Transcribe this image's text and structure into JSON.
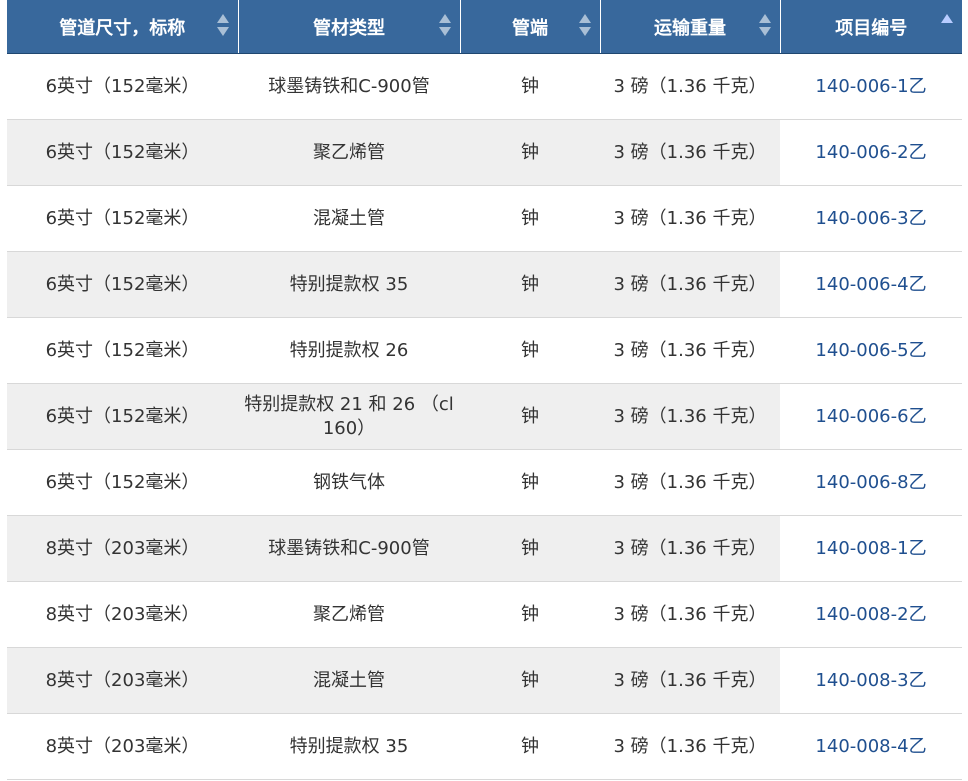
{
  "table": {
    "headers": [
      "管道尺寸，标称",
      "管材类型",
      "管端",
      "运输重量",
      "项目编号"
    ],
    "rows": [
      {
        "size": "6英寸（152毫米）",
        "material": "球墨铸铁和C-900管",
        "end": "钟",
        "weight": "3 磅（1.36 千克）",
        "item": "140-006-1乙"
      },
      {
        "size": "6英寸（152毫米）",
        "material": "聚乙烯管",
        "end": "钟",
        "weight": "3 磅（1.36 千克）",
        "item": "140-006-2乙"
      },
      {
        "size": "6英寸（152毫米）",
        "material": "混凝土管",
        "end": "钟",
        "weight": "3 磅（1.36 千克）",
        "item": "140-006-3乙"
      },
      {
        "size": "6英寸（152毫米）",
        "material": "特别提款权 35",
        "end": "钟",
        "weight": "3 磅（1.36 千克）",
        "item": "140-006-4乙"
      },
      {
        "size": "6英寸（152毫米）",
        "material": "特别提款权 26",
        "end": "钟",
        "weight": "3 磅（1.36 千克）",
        "item": "140-006-5乙"
      },
      {
        "size": "6英寸（152毫米）",
        "material": "特别提款权 21 和 26 （cl 160）",
        "end": "钟",
        "weight": "3 磅（1.36 千克）",
        "item": "140-006-6乙"
      },
      {
        "size": "6英寸（152毫米）",
        "material": "钢铁气体",
        "end": "钟",
        "weight": "3 磅（1.36 千克）",
        "item": "140-006-8乙"
      },
      {
        "size": "8英寸（203毫米）",
        "material": "球墨铸铁和C-900管",
        "end": "钟",
        "weight": "3 磅（1.36 千克）",
        "item": "140-008-1乙"
      },
      {
        "size": "8英寸（203毫米）",
        "material": "聚乙烯管",
        "end": "钟",
        "weight": "3 磅（1.36 千克）",
        "item": "140-008-2乙"
      },
      {
        "size": "8英寸（203毫米）",
        "material": "混凝土管",
        "end": "钟",
        "weight": "3 磅（1.36 千克）",
        "item": "140-008-3乙"
      },
      {
        "size": "8英寸（203毫米）",
        "material": "特别提款权 35",
        "end": "钟",
        "weight": "3 磅（1.36 千克）",
        "item": "140-008-4乙"
      }
    ]
  },
  "colors": {
    "header_bg": "#38689c",
    "stripe_bg": "#efefef",
    "item_text": "#1f4f8f"
  }
}
